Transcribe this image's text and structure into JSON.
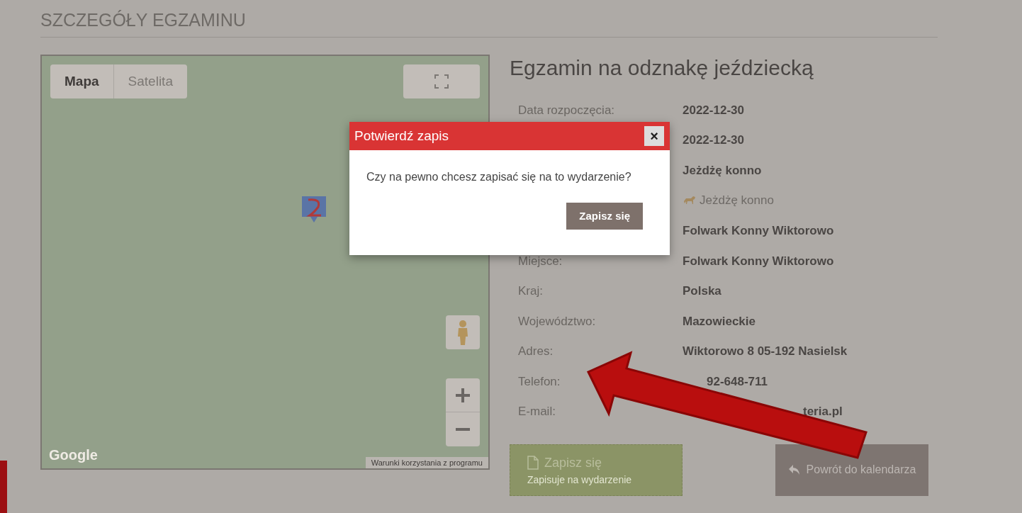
{
  "section_title": "SZCZEGÓŁY EGZAMINU",
  "map": {
    "map_type_tabs": [
      {
        "label": "Mapa",
        "selected": true
      },
      {
        "label": "Satelita",
        "selected": false
      }
    ],
    "logo": "Google",
    "terms_link": "Warunki korzystania z programu"
  },
  "event": {
    "title": "Egzamin na odznakę jeździecką",
    "details": [
      {
        "kind": "text",
        "label": "Data rozpoczęcia:",
        "value": "2022-12-30"
      },
      {
        "kind": "text",
        "value": "2022-12-30"
      },
      {
        "kind": "text",
        "value": "Jeżdżę konno"
      },
      {
        "kind": "category",
        "value": "Jeżdżę konno"
      },
      {
        "kind": "text",
        "value": "Folwark Konny Wiktorowo"
      },
      {
        "kind": "text",
        "label": "Miejsce:",
        "value": "Folwark Konny Wiktorowo"
      },
      {
        "kind": "text",
        "label": "Kraj:",
        "value": "Polska"
      },
      {
        "kind": "text",
        "label": "Województwo:",
        "value": "Mazowieckie"
      },
      {
        "kind": "text",
        "label": "Adres:",
        "value": "Wiktorowo 8 05-192 Nasielsk"
      },
      {
        "kind": "shifted",
        "label": "Telefon:",
        "value": "92-648-711"
      },
      {
        "kind": "partial",
        "label": "E-mail:",
        "value": "teria.pl"
      }
    ]
  },
  "actions": {
    "register_button": {
      "label": "Zapisz się",
      "subtitle": "Zapisuje na wydarzenie"
    },
    "back_button": {
      "label": "Powrót do kalendarza"
    }
  },
  "modal": {
    "title": "Potwierdź zapis",
    "close": "×",
    "message": "Czy na pewno chcesz zapisać się na to wydarzenie?",
    "confirm_button": "Zapisz się"
  }
}
